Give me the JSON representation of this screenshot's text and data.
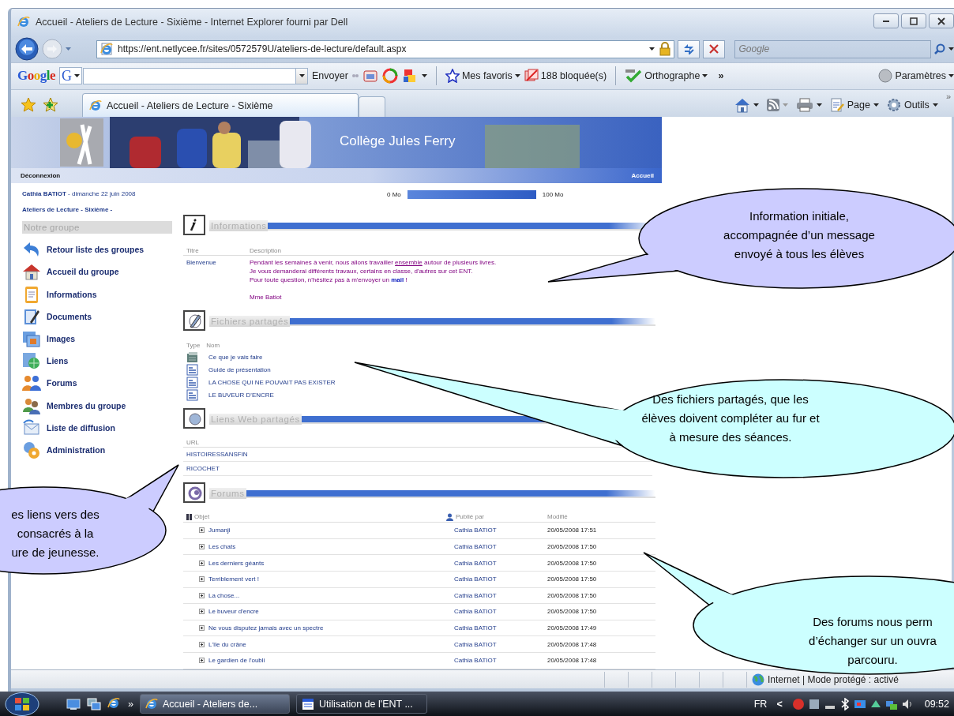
{
  "window": {
    "title": "Accueil - Ateliers de Lecture - Sixième - Internet Explorer fourni par Dell"
  },
  "address_bar": {
    "url": "https://ent.netlycee.fr/sites/0572579U/ateliers-de-lecture/default.aspx"
  },
  "search_box": {
    "placeholder": "Google"
  },
  "google_toolbar": {
    "logo": "Google",
    "engine_button": "G",
    "send": "Envoyer",
    "favorites": "Mes favoris",
    "blocked": "188 bloquée(s)",
    "spelling": "Orthographe",
    "more": "»",
    "settings": "Paramètres"
  },
  "tabs": [
    {
      "label": "Accueil - Ateliers de Lecture - Sixième",
      "selected": true
    }
  ],
  "command_bar": {
    "page": "Page",
    "tools": "Outils",
    "more": "»"
  },
  "site": {
    "banner_title": "Collège Jules Ferry",
    "logout": "Déconnexion",
    "home": "Accueil",
    "user_line": "**Cathia BATIOT** - dimanche 22 juin 2008",
    "group_title": "Ateliers de Lecture - Sixième -",
    "quota": {
      "min": "0 Mo",
      "max": "100 Mo",
      "level": 1
    },
    "sidebar": {
      "heading": "Notre groupe",
      "items": [
        "Retour liste des groupes",
        "Accueil du groupe",
        "Informations",
        "Documents",
        "Images",
        "Liens",
        "Forums",
        "Membres du groupe",
        "Liste de diffusion",
        "Administration"
      ]
    },
    "sections": [
      {
        "kind": "info",
        "title": "Informations",
        "columns": [
          "Titre",
          "Description"
        ],
        "rows": [
          {
            "title": "Bienvenue",
            "lines": [
              {
                "text": "Pendant les semaines à venir, nous allons travailler ",
                "link": "ensemble",
                "kind": "underline",
                "after": " autour de plusieurs livres."
              },
              {
                "text": "Je vous demanderai différents travaux, certains en classe, d'autres sur cet ENT."
              },
              {
                "text": "Pour toute question, n'hésitez pas à m'envoyer un ",
                "link": "mail",
                "kind": "bold",
                "after": " !"
              }
            ],
            "signature": "Mme Batiot"
          }
        ]
      },
      {
        "kind": "files",
        "title": "Fichiers partagés",
        "columns": [
          "Type",
          "Nom"
        ],
        "items": [
          {
            "name": "Ce que je vais faire",
            "kind": "page"
          },
          {
            "name": "Guide de présentation",
            "kind": "document"
          },
          {
            "name": "LA CHOSE QUI NE POUVAIT PAS EXISTER",
            "kind": "document"
          },
          {
            "name": "LE BUVEUR D'ENCRE",
            "kind": "document"
          }
        ]
      },
      {
        "kind": "links",
        "title": "Liens Web partagés",
        "columns": [
          "URL"
        ],
        "items": [
          "HISTOIRESSANSFIN",
          "RICOCHET"
        ]
      },
      {
        "kind": "forums",
        "title": "Forums",
        "columns": [
          "Objet",
          "Publié par",
          "Modifié"
        ],
        "rows": [
          {
            "title": "Jumanji",
            "author": "Cathia BATIOT",
            "modified": "20/05/2008 17:51"
          },
          {
            "title": "Les chats",
            "author": "Cathia BATIOT",
            "modified": "20/05/2008 17:50"
          },
          {
            "title": "Les derniers géants",
            "author": "Cathia BATIOT",
            "modified": "20/05/2008 17:50"
          },
          {
            "title": "Terriblement vert !",
            "author": "Cathia BATIOT",
            "modified": "20/05/2008 17:50"
          },
          {
            "title": "La chose...",
            "author": "Cathia BATIOT",
            "modified": "20/05/2008 17:50"
          },
          {
            "title": "Le buveur d'encre",
            "author": "Cathia BATIOT",
            "modified": "20/05/2008 17:50"
          },
          {
            "title": "Ne vous disputez jamais avec un spectre",
            "author": "Cathia BATIOT",
            "modified": "20/05/2008 17:49"
          },
          {
            "title": "L'île du crâne",
            "author": "Cathia BATIOT",
            "modified": "20/05/2008 17:48"
          },
          {
            "title": "Le gardien de l'oubli",
            "author": "Cathia BATIOT",
            "modified": "20/05/2008 17:48"
          }
        ]
      }
    ]
  },
  "status_bar": {
    "zone": "Internet | Mode protégé : activé"
  },
  "taskbar": {
    "more": "»",
    "tasks": [
      {
        "label": "Accueil - Ateliers de...",
        "selected": true
      },
      {
        "label": "Utilisation de l'ENT ...",
        "selected": false
      }
    ],
    "language": "FR",
    "tray_expand": "<",
    "clock": "09:52"
  },
  "callouts": [
    {
      "color": "#ccccff",
      "lines": [
        "Information initiale,",
        "accompagnée d’un message",
        "envoyé à tous les élèves"
      ]
    },
    {
      "color": "#ccffff",
      "lines": [
        "Des fichiers partagés, que les",
        "élèves doivent compléter au fur et",
        "à mesure des séances."
      ]
    },
    {
      "color": "#ccccff",
      "lines": [
        "es liens vers des",
        "consacrés à la",
        "ure de jeunesse."
      ]
    },
    {
      "color": "#ccffff",
      "lines": [
        "Des forums nous perm",
        "d’échanger sur un ouvra",
        "parcouru."
      ]
    }
  ]
}
